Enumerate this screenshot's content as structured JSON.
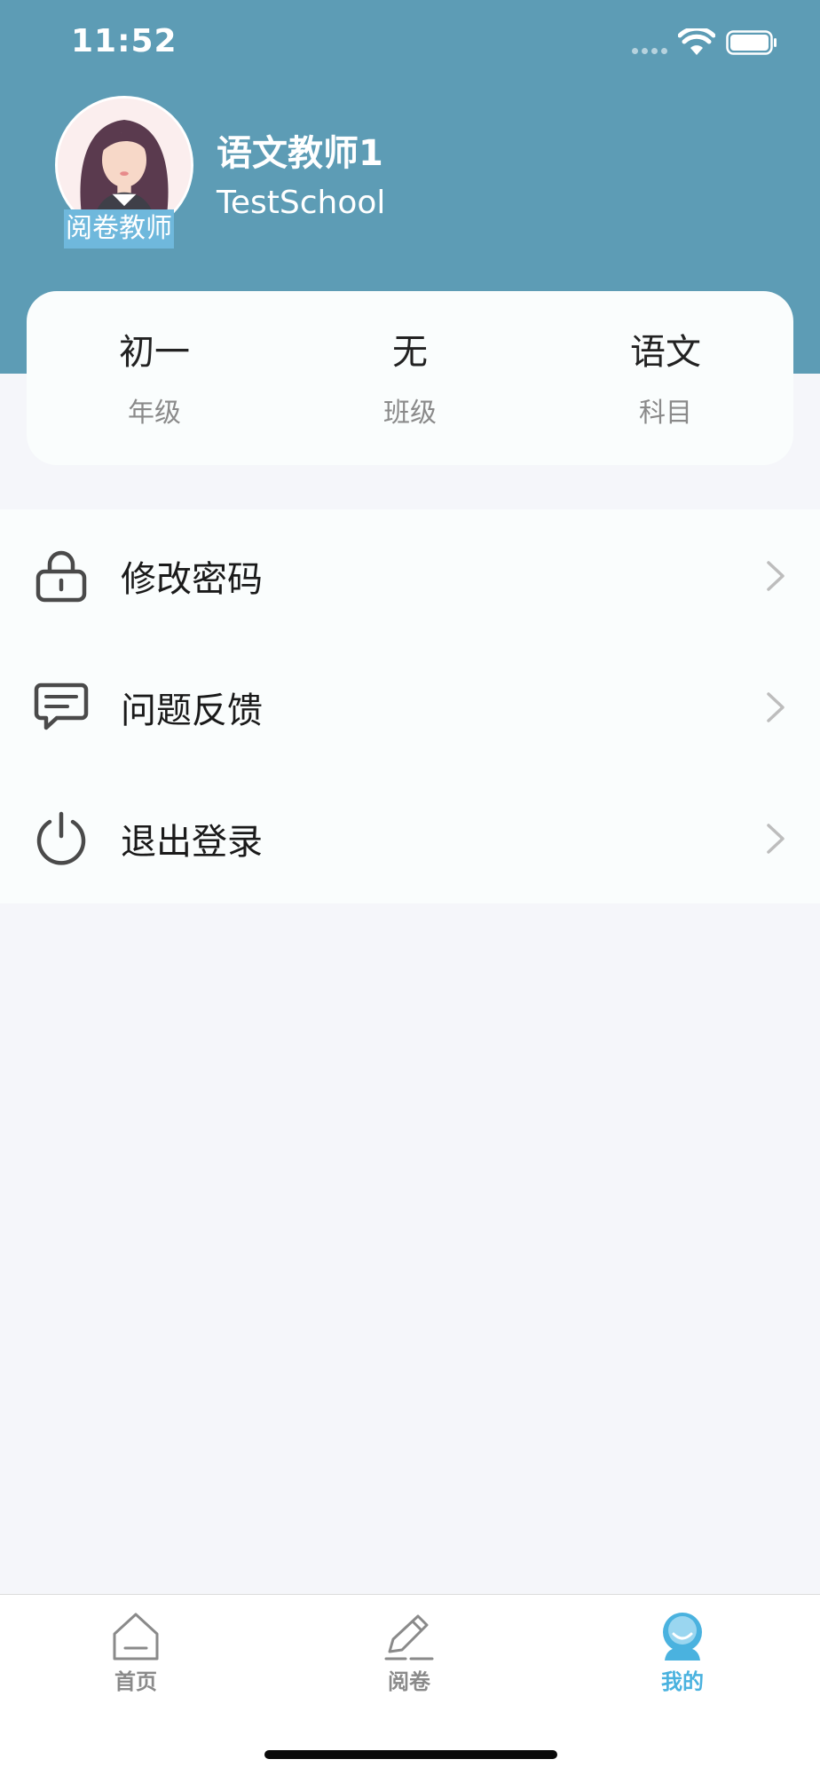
{
  "status_bar": {
    "time": "11:52",
    "wifi_icon": "wifi-icon",
    "battery_icon": "battery-full-icon"
  },
  "profile": {
    "role_badge": "阅卷教师",
    "name": "语文教师1",
    "school": "TestSchool",
    "header_color": "#5d9cb5"
  },
  "info": [
    {
      "value": "初一",
      "label": "年级"
    },
    {
      "value": "无",
      "label": "班级"
    },
    {
      "value": "语文",
      "label": "科目"
    }
  ],
  "menu": [
    {
      "label": "修改密码",
      "icon": "lock-icon"
    },
    {
      "label": "问题反馈",
      "icon": "feedback-icon"
    },
    {
      "label": "退出登录",
      "icon": "power-icon"
    }
  ],
  "tabs": [
    {
      "label": "首页",
      "icon": "home-icon",
      "active": false
    },
    {
      "label": "阅卷",
      "icon": "pen-icon",
      "active": false
    },
    {
      "label": "我的",
      "icon": "profile-icon",
      "active": true
    }
  ],
  "colors": {
    "accent": "#4ab2df",
    "inactive_tab": "#8a8a8a"
  }
}
